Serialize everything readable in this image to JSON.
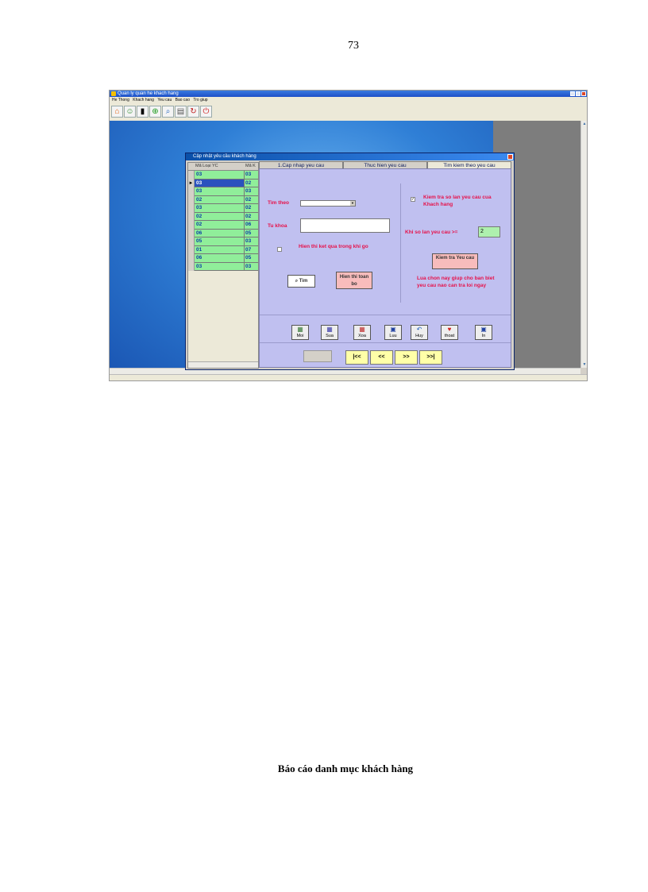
{
  "page_number": "73",
  "caption": "Báo cáo danh mục khách hàng",
  "app": {
    "title": "Quan ly quan he khach hang",
    "menu": [
      "He Thong",
      "Khach hang",
      "Yeu cau",
      "Bao cao",
      "Tro giup"
    ],
    "toolbar_icons": [
      "home-icon",
      "people-icon",
      "chart-icon",
      "add-icon",
      "search-icon",
      "print-icon",
      "refresh-icon",
      "power-icon"
    ]
  },
  "dialog": {
    "title": "Cập nhật yêu cầu khách hàng",
    "grid": {
      "headers": [
        "Mã Loại YC",
        "Mã K"
      ],
      "rows": [
        [
          "03",
          "03"
        ],
        [
          "03",
          "02"
        ],
        [
          "03",
          "03"
        ],
        [
          "02",
          "02"
        ],
        [
          "03",
          "02"
        ],
        [
          "02",
          "02"
        ],
        [
          "02",
          "06"
        ],
        [
          "06",
          "05"
        ],
        [
          "05",
          "03"
        ],
        [
          "01",
          "07"
        ],
        [
          "06",
          "05"
        ],
        [
          "03",
          "03"
        ]
      ]
    },
    "tabs": [
      "1.Cap nhap yeu cau",
      "Thuc hien yeu cau",
      "Tim kiem theo yeu cau"
    ],
    "search": {
      "find_by_label": "Tim theo",
      "keyword_label": "Tu khoa",
      "show_result_label": "Hien thi ket qua trong khi go",
      "find_button": "Tim",
      "show_all_button": "Hien thi toan bo",
      "check_count_label": "Kiem tra so lan yeu cau cua Khach hang",
      "times_label": "Khi so lan yeu cau >=",
      "times_value": "2",
      "check_button": "Kiem tra Yeu cau",
      "hint": "Lua chon nay giup cho ban biet yeu cau nao can tra loi ngay"
    },
    "actions": [
      "Moi",
      "Sua",
      "Xoa",
      "Luu",
      "Huy",
      "thoat",
      "In"
    ],
    "nav": [
      "|<<",
      "<<",
      ">>",
      ">>|"
    ]
  }
}
